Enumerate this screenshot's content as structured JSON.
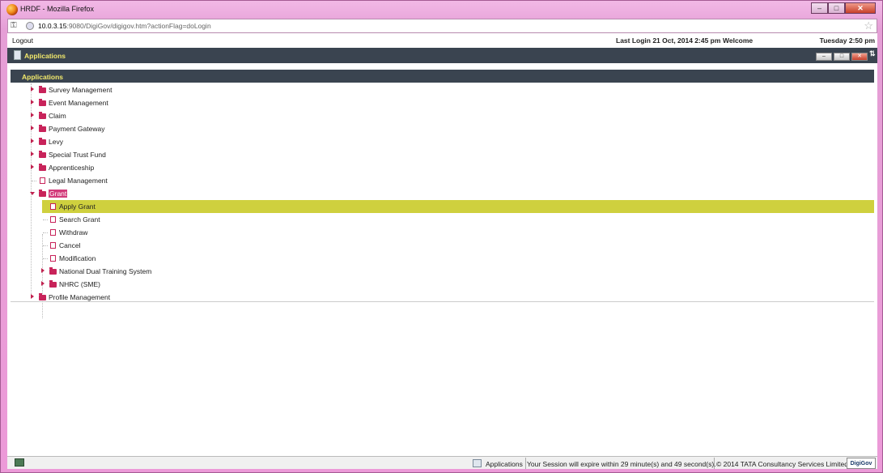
{
  "window": {
    "title": "HRDF - Mozilla Firefox"
  },
  "browser": {
    "url_host": "10.0.3.15",
    "url_rest": ":9080/DigiGov/digigov.htm?actionFlag=doLogin"
  },
  "topinfo": {
    "logout": "Logout",
    "last_login": "Last Login 21 Oct, 2014 2:45 pm",
    "welcome": "Welcome",
    "datetime": "Tuesday 2:50 pm"
  },
  "appbar": {
    "title": "Applications"
  },
  "section": {
    "title": "Applications"
  },
  "tree": {
    "items": [
      {
        "label": "Survey Management"
      },
      {
        "label": "Event Management"
      },
      {
        "label": "Claim"
      },
      {
        "label": "Payment Gateway"
      },
      {
        "label": "Levy"
      },
      {
        "label": "Special Trust Fund"
      },
      {
        "label": "Apprenticeship"
      },
      {
        "label": "Legal Management"
      },
      {
        "label": "Grant"
      },
      {
        "label": "Apply Grant"
      },
      {
        "label": "Search Grant"
      },
      {
        "label": "Withdraw"
      },
      {
        "label": "Cancel"
      },
      {
        "label": "Modification"
      },
      {
        "label": "National Dual Training System"
      },
      {
        "label": "NHRC (SME)"
      },
      {
        "label": "Profile Management"
      }
    ]
  },
  "status": {
    "app": "Applications",
    "session": "Your Session will expire within 29 minute(s) and 49 second(s).",
    "copyright": "© 2014 TATA Consultancy Services Limited",
    "logo": "DigiGov"
  },
  "colors": {
    "header_bg": "#3a4450",
    "header_text": "#f2e96b",
    "highlight": "#cfd03e",
    "folder": "#c8235a"
  }
}
